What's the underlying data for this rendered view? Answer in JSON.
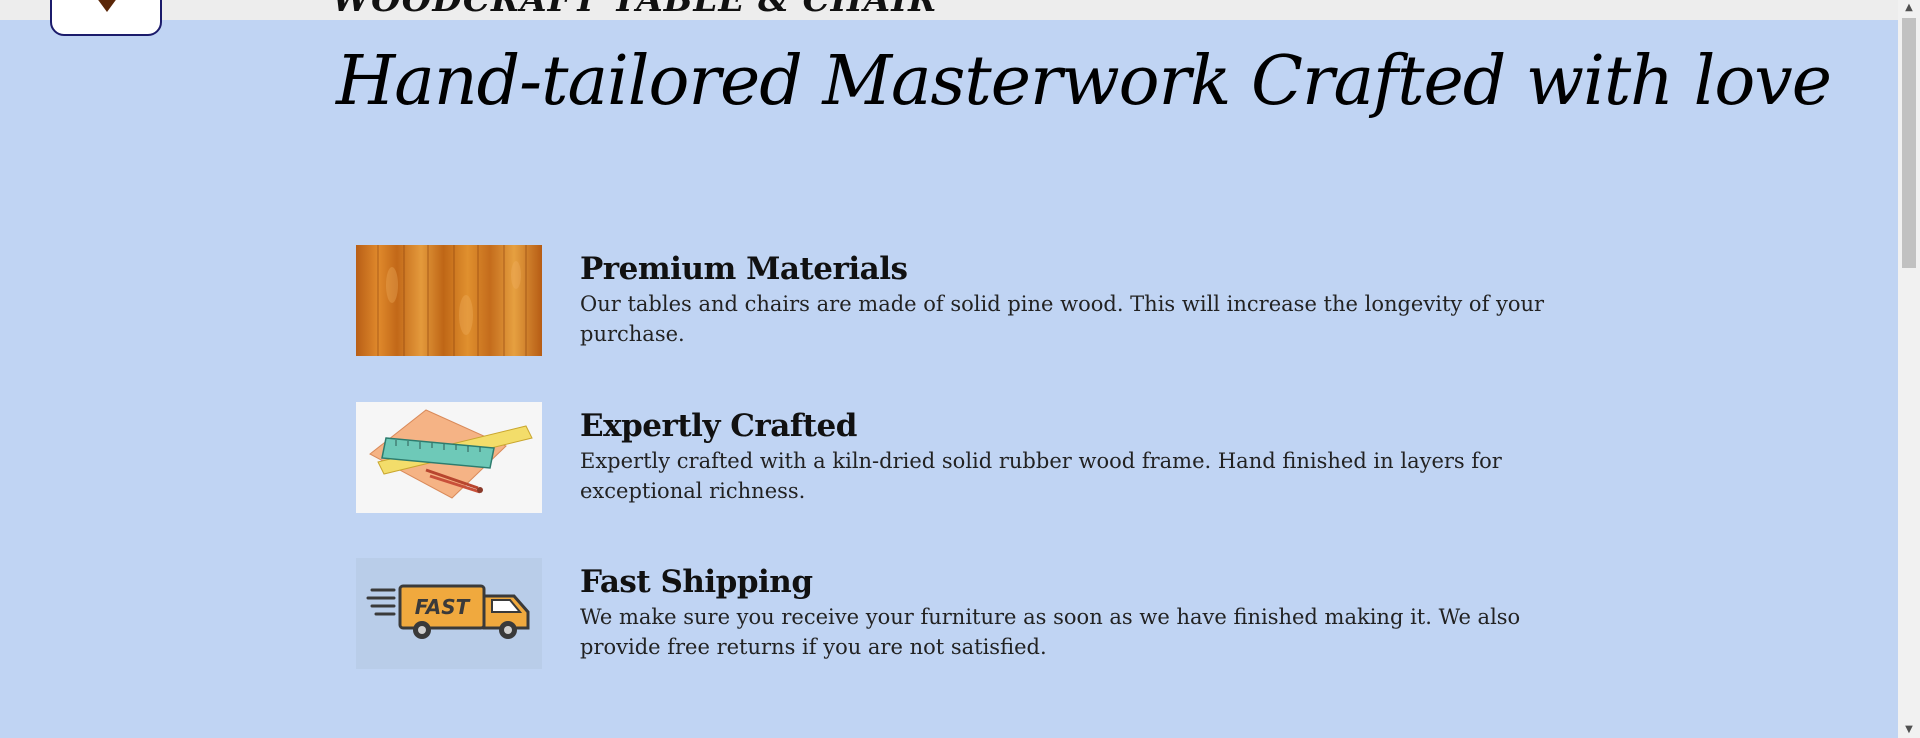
{
  "header": {
    "brand_name": "WOODCRAFT TABLE & CHAIR"
  },
  "hero": {
    "title": "Hand-tailored Masterwork Crafted with love"
  },
  "features": [
    {
      "icon": "wood-texture-image",
      "title": "Premium Materials",
      "description": "Our tables and chairs are made of solid pine wood. This will increase the longevity of your purchase."
    },
    {
      "icon": "ruler-pencil-image",
      "title": "Expertly Crafted",
      "description": "Expertly crafted with a kiln-dried solid rubber wood frame. Hand finished in layers for exceptional richness."
    },
    {
      "icon": "fast-truck-image",
      "title": "Fast Shipping",
      "description": "We make sure you receive your furniture as soon as we have finished making it. We also provide free returns if you are not satisfied."
    }
  ],
  "truck_label": "FAST",
  "scrollbar": {
    "up_arrow": "▲",
    "down_arrow": "▼"
  },
  "colors": {
    "page_background": "#c0d4f3",
    "header_background": "#ededed",
    "logo_border": "#1b1b6b",
    "wood": "#c8701e"
  }
}
